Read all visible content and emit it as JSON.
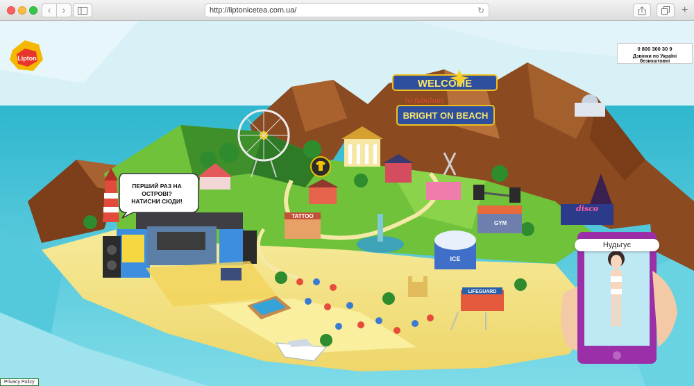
{
  "browser": {
    "url": "http://liptonicetea.com.ua/"
  },
  "brand": {
    "logo_text": "Lipton"
  },
  "phone_call": {
    "number": "0 800 300 30 9",
    "text": "Дзвінки по Україні безкоштовні"
  },
  "speech_bubble": {
    "text": "ПЕРШИЙ РАЗ НА ОСТРОВІ? НАТИСНИ СЮДИ!"
  },
  "welcome_sign": {
    "top": "WELCOME",
    "middle": "to fabulous",
    "bottom": "BRIGHT ON BEACH"
  },
  "buildings": {
    "gym": "GYM",
    "tattoo": "TATTOO",
    "ice": "ICE",
    "lifeguard": "LIFEGUARD",
    "disco": "disco"
  },
  "phone_widget": {
    "caption": "Нудьгує"
  },
  "footer": {
    "privacy": "Privacy Policy"
  },
  "colors": {
    "sea": "#37c3d6",
    "sky": "#cfeff6",
    "grass": "#6fc23a",
    "sand": "#f3e28a",
    "phone": "#9b2fa8"
  }
}
